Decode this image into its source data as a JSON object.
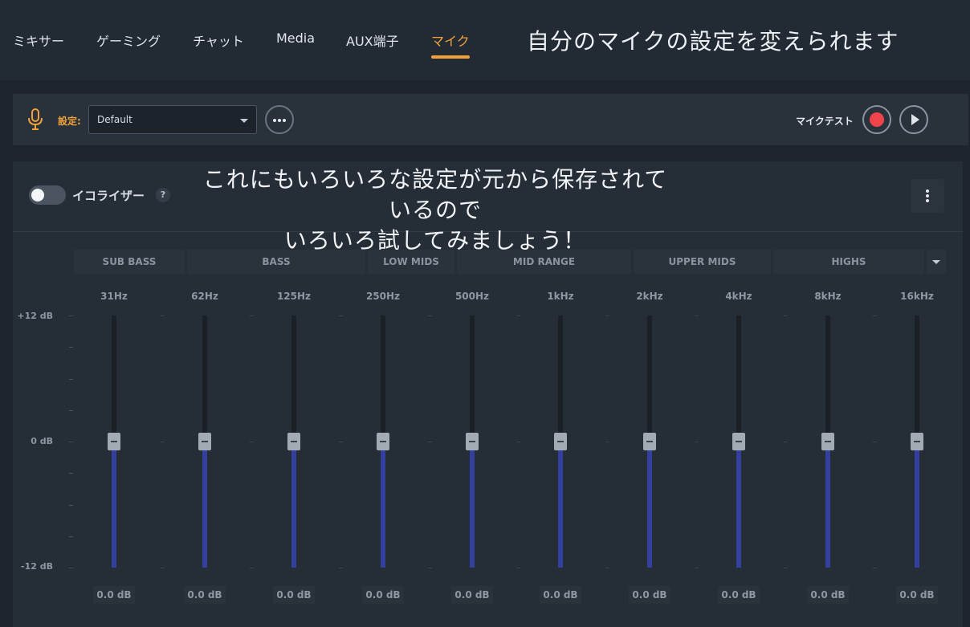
{
  "tabs": [
    {
      "label": "ミキサー",
      "active": false
    },
    {
      "label": "ゲーミング",
      "active": false
    },
    {
      "label": "チャット",
      "active": false
    },
    {
      "label": "Media",
      "active": false
    },
    {
      "label": "AUX端子",
      "active": false
    },
    {
      "label": "マイク",
      "active": true
    }
  ],
  "tabs_note": "自分のマイクの設定を変えられます",
  "device_bar": {
    "icon": "microphone-icon",
    "preset_label": "設定:",
    "preset_value": "Default",
    "more_icon": "more-horizontal-icon",
    "mictest_label": "マイクテスト",
    "record_icon": "record-icon",
    "play_icon": "play-icon"
  },
  "eq": {
    "enabled": false,
    "title": "イコライザー",
    "help": "?",
    "note_line1": "これにもいろいろな設定が元から保存されているので",
    "note_line2": "いろいろ試してみましょう！",
    "menu_icon": "more-vertical-icon",
    "ranges": [
      "SUB BASS",
      "BASS",
      "LOW MIDS",
      "MID RANGE",
      "UPPER MIDS",
      "HIGHS"
    ],
    "range_menu_icon": "chevron-down-icon",
    "axis": {
      "max_label": "+12 dB",
      "mid_label": "0 dB",
      "min_label": "-12 dB",
      "max": 12,
      "min": -12
    },
    "bands": [
      {
        "freq": "31Hz",
        "gain": 0,
        "value": "0.0 dB"
      },
      {
        "freq": "62Hz",
        "gain": 0,
        "value": "0.0 dB"
      },
      {
        "freq": "125Hz",
        "gain": 0,
        "value": "0.0 dB"
      },
      {
        "freq": "250Hz",
        "gain": 0,
        "value": "0.0 dB"
      },
      {
        "freq": "500Hz",
        "gain": 0,
        "value": "0.0 dB"
      },
      {
        "freq": "1kHz",
        "gain": 0,
        "value": "0.0 dB"
      },
      {
        "freq": "2kHz",
        "gain": 0,
        "value": "0.0 dB"
      },
      {
        "freq": "4kHz",
        "gain": 0,
        "value": "0.0 dB"
      },
      {
        "freq": "8kHz",
        "gain": 0,
        "value": "0.0 dB"
      },
      {
        "freq": "16kHz",
        "gain": 0,
        "value": "0.0 dB"
      }
    ]
  },
  "colors": {
    "accent": "#f2a13a",
    "record": "#f0444a",
    "eq_fill": "#3340a0"
  }
}
